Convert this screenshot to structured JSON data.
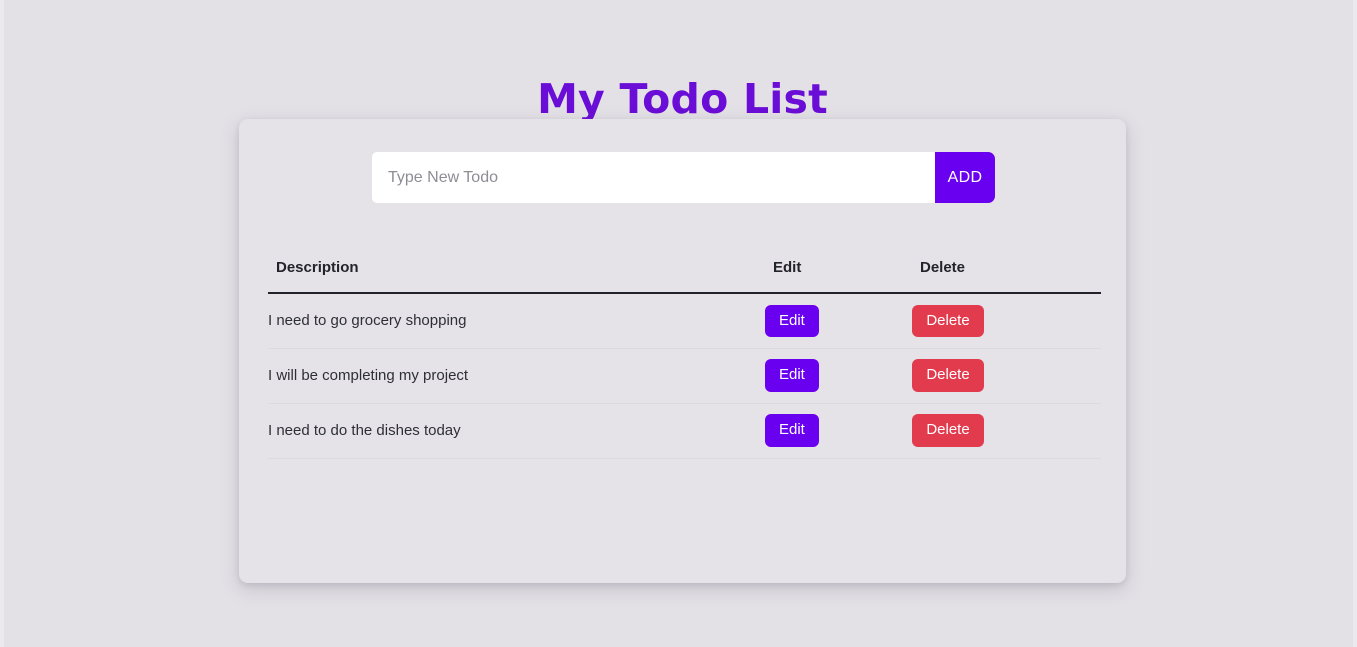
{
  "header": {
    "title": "My Todo List",
    "title_color": "#6a0dd6"
  },
  "card": {
    "background_color": "#e5e3e8"
  },
  "new_todo": {
    "placeholder": "Type New Todo",
    "value": "",
    "add_label": "ADD",
    "add_color": "#6a00f0"
  },
  "table": {
    "columns": {
      "description": "Description",
      "edit": "Edit",
      "delete": "Delete"
    },
    "rows": [
      {
        "description": "I need to go grocery shopping",
        "edit_label": "Edit",
        "delete_label": "Delete"
      },
      {
        "description": "I will be completing my project",
        "edit_label": "Edit",
        "delete_label": "Delete"
      },
      {
        "description": "I need to do the dishes today",
        "edit_label": "Edit",
        "delete_label": "Delete"
      }
    ],
    "edit_color": "#6a00f0",
    "delete_color": "#e23b4e"
  },
  "page": {
    "background_color": "#e3e1e6"
  }
}
